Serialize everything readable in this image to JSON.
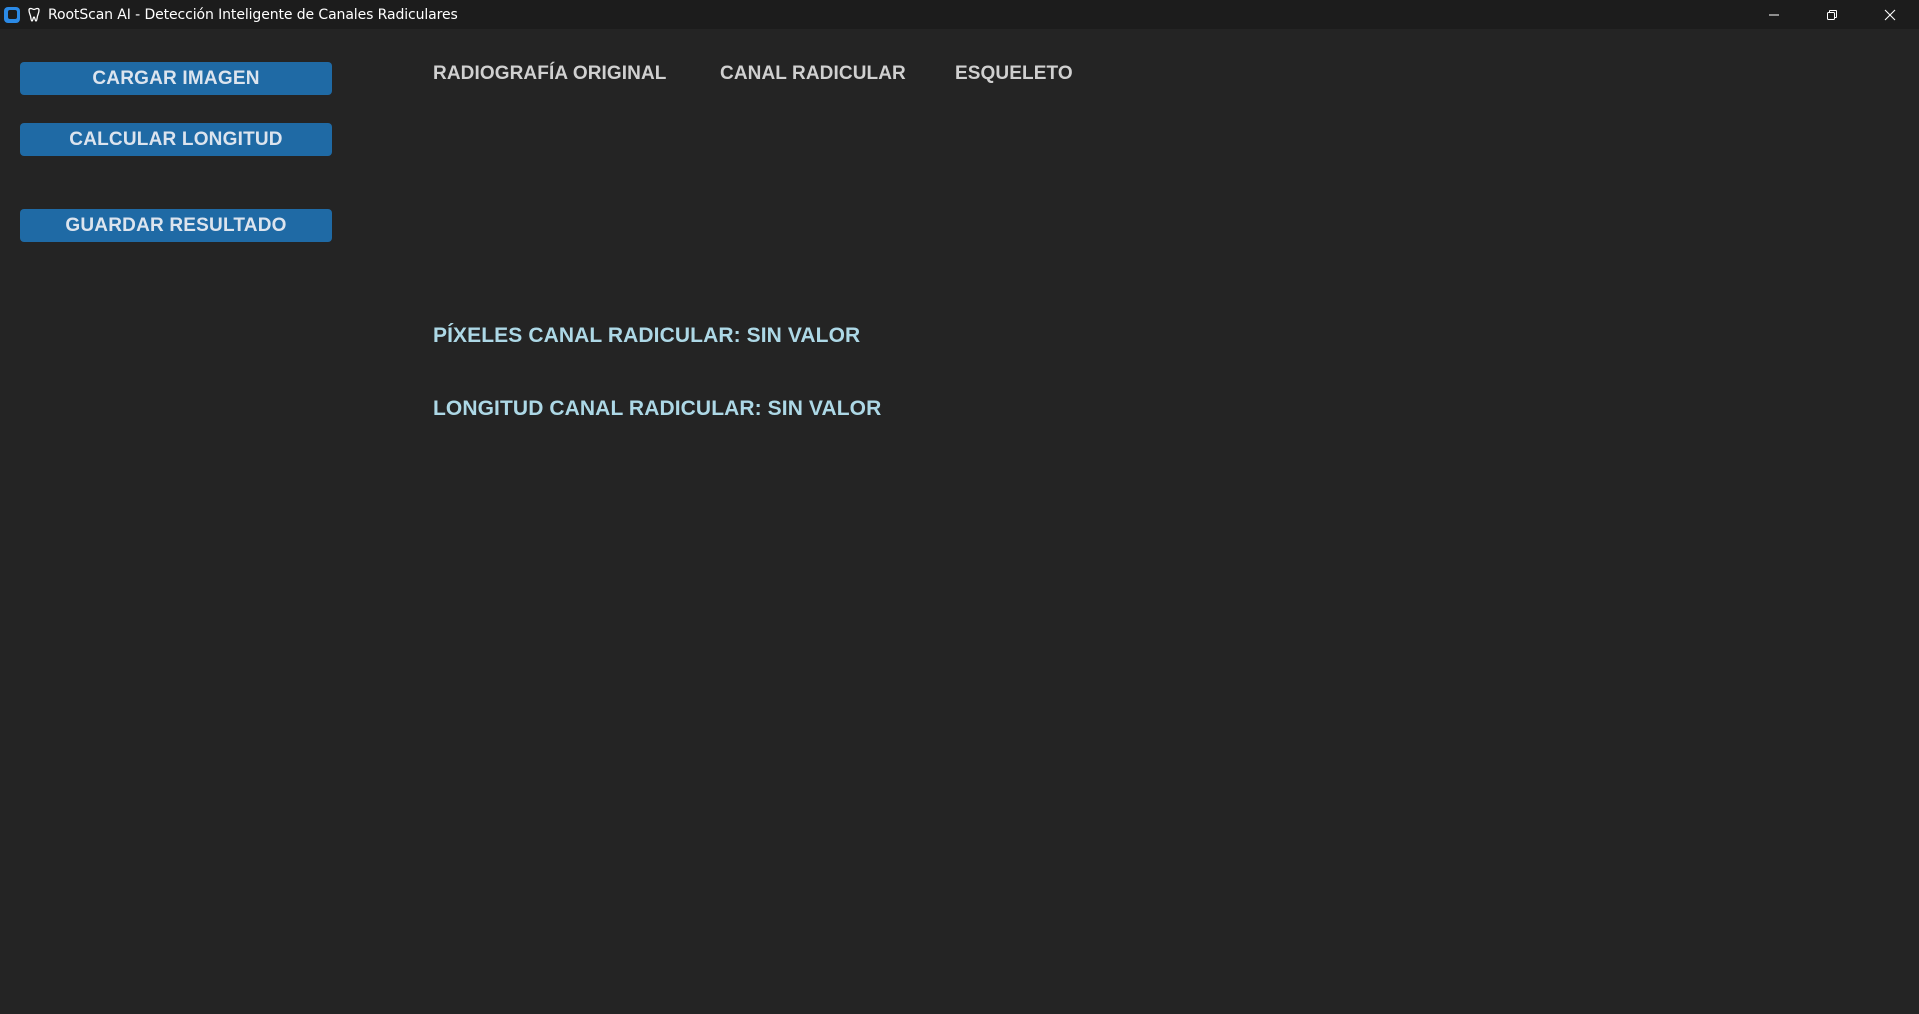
{
  "window": {
    "title": "RootScan AI - Detección Inteligente de Canales Radiculares",
    "icons": [
      "app-icon",
      "tooth-icon",
      "minimize-icon",
      "restore-icon",
      "close-icon"
    ]
  },
  "sidebar": {
    "buttons": [
      {
        "label": "CARGAR IMAGEN"
      },
      {
        "label": "CALCULAR LONGITUD"
      },
      {
        "label": "GUARDAR RESULTADO"
      }
    ]
  },
  "tabs": [
    {
      "label": "RADIOGRAFÍA ORIGINAL"
    },
    {
      "label": "CANAL RADICULAR"
    },
    {
      "label": "ESQUELETO"
    }
  ],
  "results": {
    "pixels": "PÍXELES CANAL RADICULAR: SIN VALOR",
    "length": "LONGITUD CANAL RADICULAR: SIN VALOR"
  },
  "colors": {
    "background": "#242424",
    "button": "#1f6aa5",
    "result_text": "#add8e6",
    "tab_text": "#d0d0d0"
  }
}
